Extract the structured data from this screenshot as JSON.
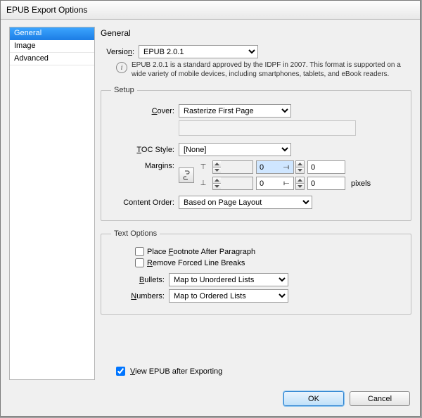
{
  "title": "EPUB Export Options",
  "sidebar": {
    "items": [
      "General",
      "Image",
      "Advanced"
    ],
    "selected": 0
  },
  "page_heading": "General",
  "version": {
    "label_pre": "Versio",
    "label_u": "n",
    "label_post": ":",
    "value": "EPUB 2.0.1"
  },
  "info": "EPUB 2.0.1 is a standard approved by the IDPF in 2007. This format is supported on a wide variety of mobile devices, including smartphones, tablets, and eBook readers.",
  "setup": {
    "legend": "Setup",
    "cover": {
      "label_u": "C",
      "label_post": "over:",
      "value": "Rasterize First Page"
    },
    "toc": {
      "label_u": "T",
      "label_post": "OC Style:",
      "value": "[None]"
    },
    "margins": {
      "label": "Margins:",
      "top": "0",
      "bottom": "0",
      "left": "0",
      "right": "0",
      "unit": "pixels"
    },
    "order": {
      "label": "Content Order:",
      "value": "Based on Page Layout"
    }
  },
  "text_options": {
    "legend": "Text Options",
    "footnote": {
      "pre": "Place ",
      "u": "F",
      "post": "ootnote After Paragraph",
      "checked": false
    },
    "remove": {
      "u": "R",
      "post": "emove Forced Line Breaks",
      "checked": false
    },
    "bullets": {
      "u": "B",
      "post": "ullets:",
      "value": "Map to Unordered Lists"
    },
    "numbers": {
      "u": "N",
      "post": "umbers:",
      "value": "Map to Ordered Lists"
    }
  },
  "view_after": {
    "u": "V",
    "post": "iew EPUB after Exporting",
    "checked": true
  },
  "buttons": {
    "ok": "OK",
    "cancel": "Cancel"
  }
}
